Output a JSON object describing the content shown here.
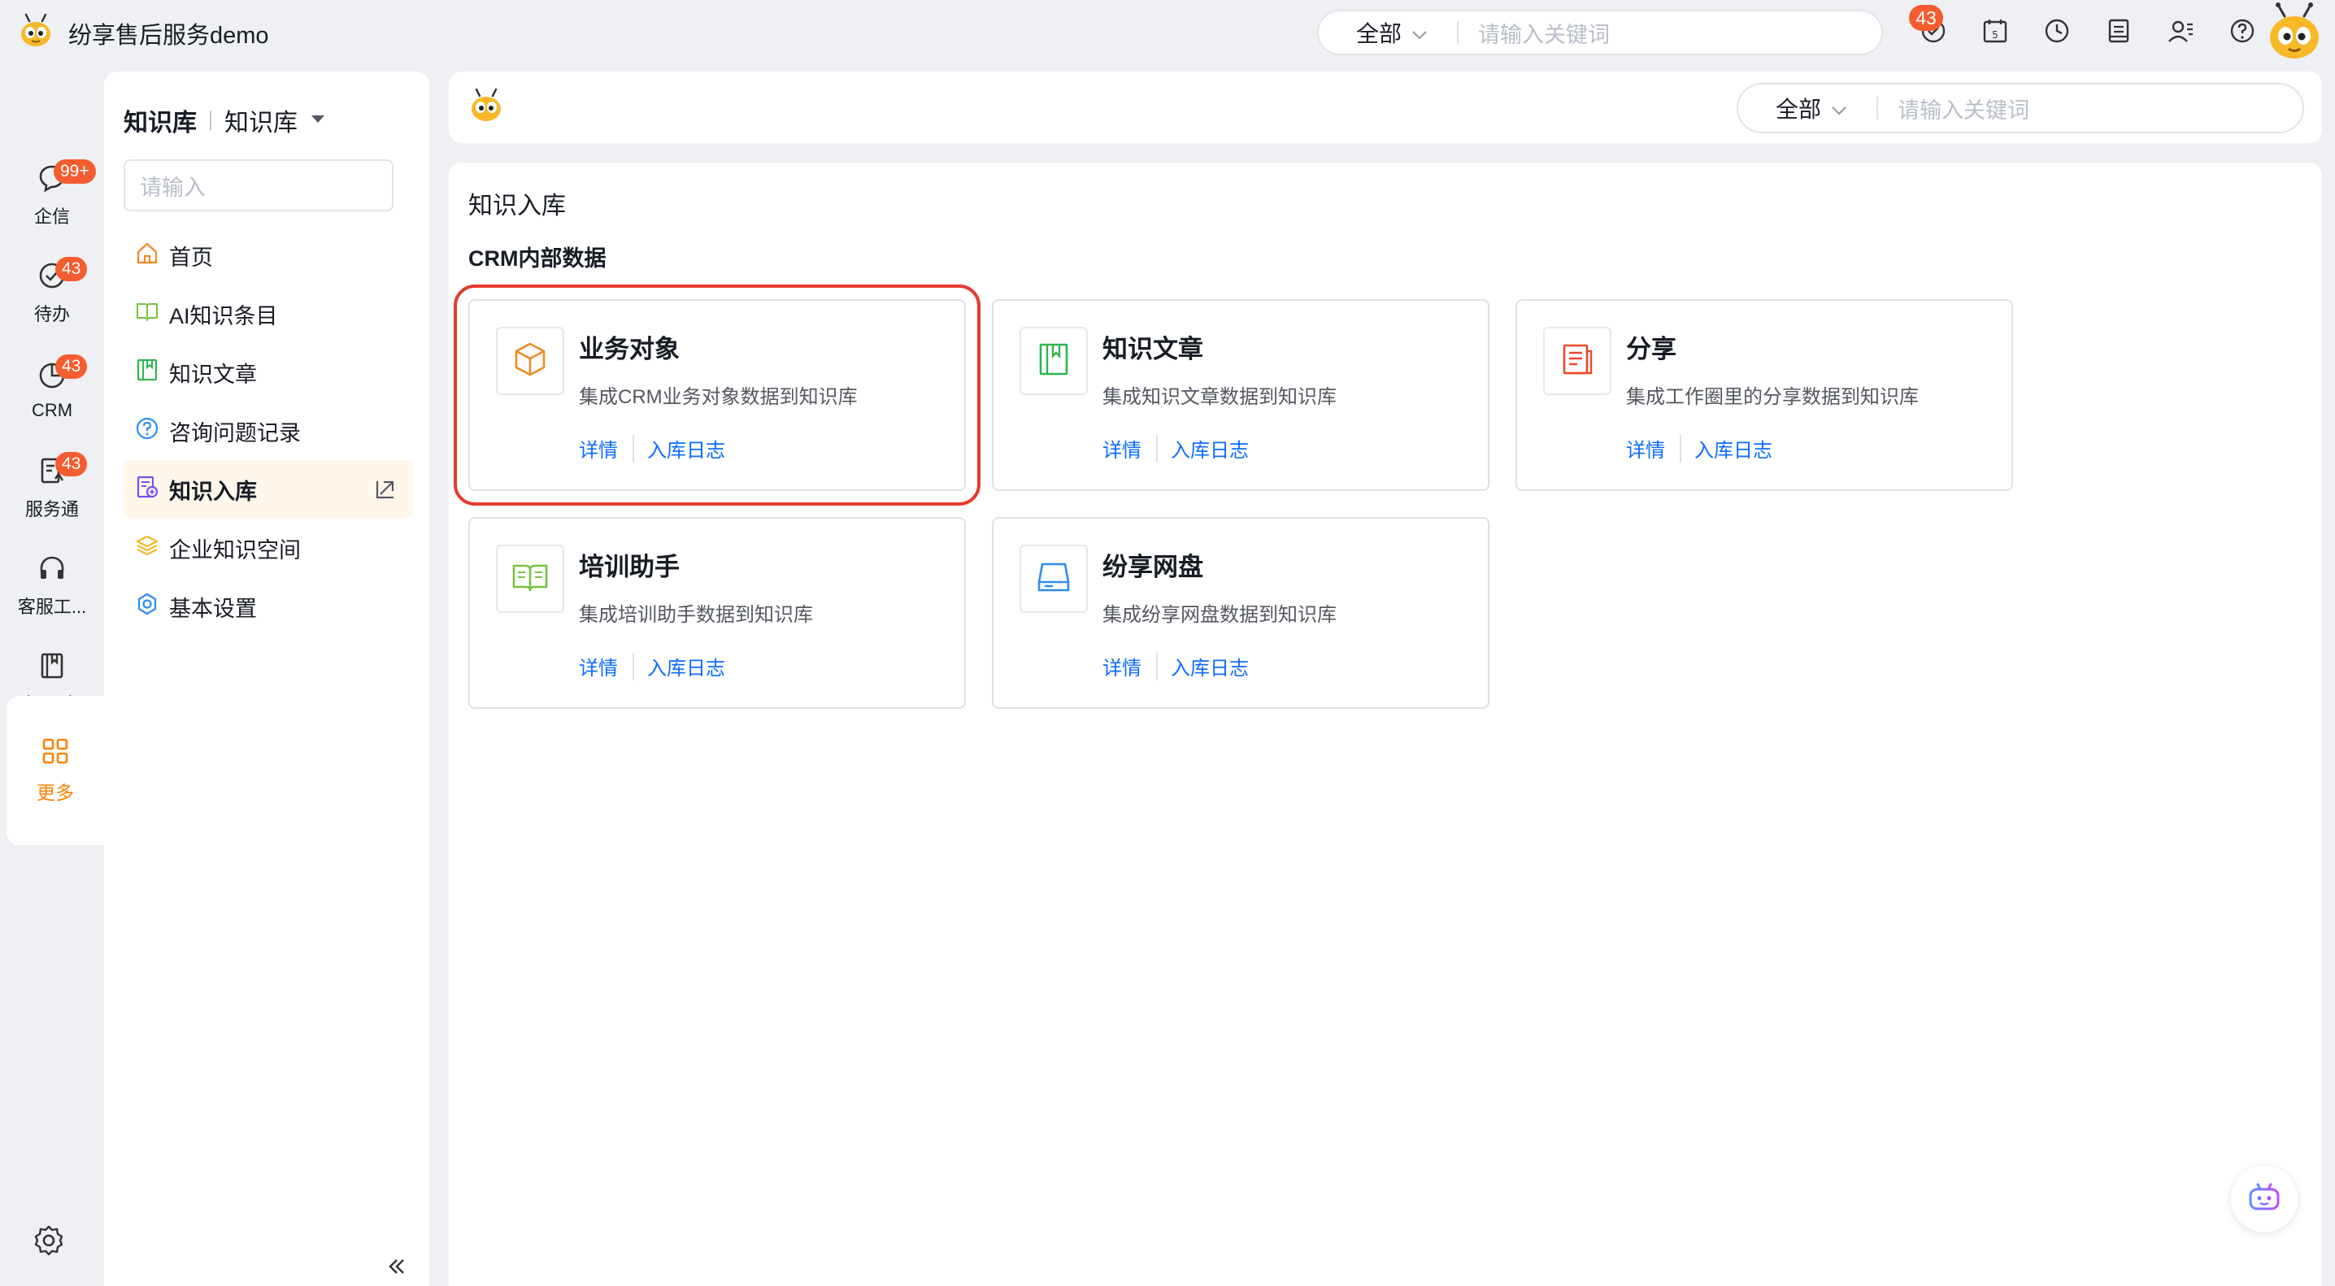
{
  "app": {
    "title": "纷享售后服务demo"
  },
  "global_search": {
    "scope": "全部",
    "placeholder": "请输入关键词"
  },
  "top_icons": [
    {
      "name": "notification-icon",
      "badge": "43"
    },
    {
      "name": "calendar-icon",
      "badge": ""
    },
    {
      "name": "clock-icon",
      "badge": ""
    },
    {
      "name": "document-icon",
      "badge": ""
    },
    {
      "name": "contacts-icon",
      "badge": ""
    },
    {
      "name": "help-icon",
      "badge": ""
    }
  ],
  "rail": {
    "items": [
      {
        "label": "企信",
        "icon": "chat-icon",
        "badge": "99+"
      },
      {
        "label": "待办",
        "icon": "todo-icon",
        "badge": "43"
      },
      {
        "label": "CRM",
        "icon": "crm-icon",
        "badge": "43"
      },
      {
        "label": "服务通",
        "icon": "service-icon",
        "badge": "43"
      },
      {
        "label": "客服工...",
        "icon": "headset-icon",
        "badge": ""
      },
      {
        "label": "知识库",
        "icon": "knowledge-icon",
        "badge": ""
      }
    ],
    "more_label": "更多"
  },
  "sidebar": {
    "title": "知识库",
    "subtitle": "知识库",
    "search_placeholder": "请输入",
    "menu": [
      {
        "label": "首页",
        "icon": "home-icon"
      },
      {
        "label": "AI知识条目",
        "icon": "book-icon"
      },
      {
        "label": "知识文章",
        "icon": "article-icon"
      },
      {
        "label": "咨询问题记录",
        "icon": "question-icon"
      },
      {
        "label": "知识入库",
        "icon": "import-icon",
        "active": true
      },
      {
        "label": "企业知识空间",
        "icon": "layers-icon"
      },
      {
        "label": "基本设置",
        "icon": "settings-icon"
      }
    ]
  },
  "main_search": {
    "scope": "全部",
    "placeholder": "请输入关键词"
  },
  "content": {
    "title": "知识入库",
    "section": "CRM内部数据",
    "cards": [
      {
        "title": "业务对象",
        "desc": "集成CRM业务对象数据到知识库",
        "detail": "详情",
        "log": "入库日志",
        "icon": "cube-icon",
        "color": "#f08a24"
      },
      {
        "title": "知识文章",
        "desc": "集成知识文章数据到知识库",
        "detail": "详情",
        "log": "入库日志",
        "icon": "article-icon",
        "color": "#30b44f"
      },
      {
        "title": "分享",
        "desc": "集成工作圈里的分享数据到知识库",
        "detail": "详情",
        "log": "入库日志",
        "icon": "share-doc-icon",
        "color": "#ea4a2a"
      },
      {
        "title": "培训助手",
        "desc": "集成培训助手数据到知识库",
        "detail": "详情",
        "log": "入库日志",
        "icon": "open-book-icon",
        "color": "#7ac143"
      },
      {
        "title": "纷享网盘",
        "desc": "集成纷享网盘数据到知识库",
        "detail": "详情",
        "log": "入库日志",
        "icon": "drive-icon",
        "color": "#2e8cf0"
      }
    ]
  },
  "colors": {
    "accent": "#ff8000",
    "badge": "#f35d2f",
    "link": "#0c6cff",
    "highlight": "#e43b2d"
  }
}
